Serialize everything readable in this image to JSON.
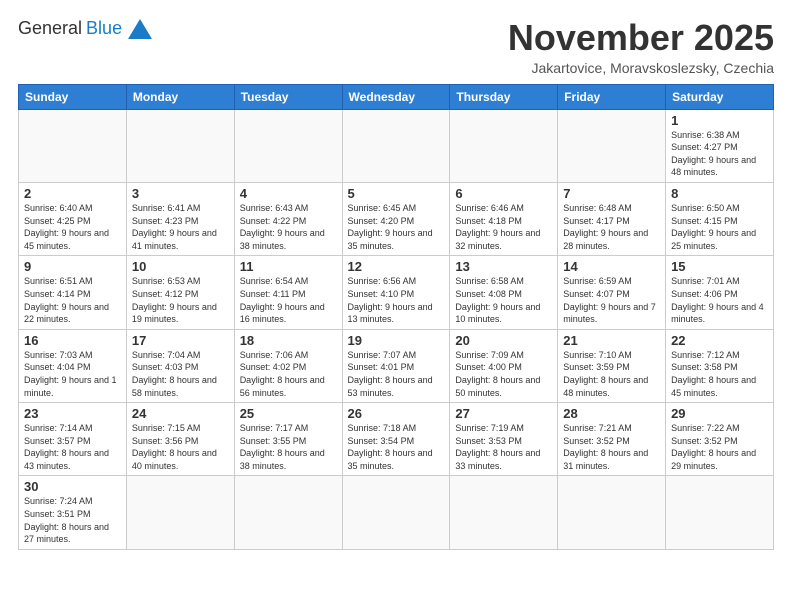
{
  "header": {
    "logo_general": "General",
    "logo_blue": "Blue",
    "month_title": "November 2025",
    "subtitle": "Jakartovice, Moravskoslezsky, Czechia"
  },
  "weekdays": [
    "Sunday",
    "Monday",
    "Tuesday",
    "Wednesday",
    "Thursday",
    "Friday",
    "Saturday"
  ],
  "weeks": [
    [
      {
        "day": "",
        "info": ""
      },
      {
        "day": "",
        "info": ""
      },
      {
        "day": "",
        "info": ""
      },
      {
        "day": "",
        "info": ""
      },
      {
        "day": "",
        "info": ""
      },
      {
        "day": "",
        "info": ""
      },
      {
        "day": "1",
        "info": "Sunrise: 6:38 AM\nSunset: 4:27 PM\nDaylight: 9 hours and 48 minutes."
      }
    ],
    [
      {
        "day": "2",
        "info": "Sunrise: 6:40 AM\nSunset: 4:25 PM\nDaylight: 9 hours and 45 minutes."
      },
      {
        "day": "3",
        "info": "Sunrise: 6:41 AM\nSunset: 4:23 PM\nDaylight: 9 hours and 41 minutes."
      },
      {
        "day": "4",
        "info": "Sunrise: 6:43 AM\nSunset: 4:22 PM\nDaylight: 9 hours and 38 minutes."
      },
      {
        "day": "5",
        "info": "Sunrise: 6:45 AM\nSunset: 4:20 PM\nDaylight: 9 hours and 35 minutes."
      },
      {
        "day": "6",
        "info": "Sunrise: 6:46 AM\nSunset: 4:18 PM\nDaylight: 9 hours and 32 minutes."
      },
      {
        "day": "7",
        "info": "Sunrise: 6:48 AM\nSunset: 4:17 PM\nDaylight: 9 hours and 28 minutes."
      },
      {
        "day": "8",
        "info": "Sunrise: 6:50 AM\nSunset: 4:15 PM\nDaylight: 9 hours and 25 minutes."
      }
    ],
    [
      {
        "day": "9",
        "info": "Sunrise: 6:51 AM\nSunset: 4:14 PM\nDaylight: 9 hours and 22 minutes."
      },
      {
        "day": "10",
        "info": "Sunrise: 6:53 AM\nSunset: 4:12 PM\nDaylight: 9 hours and 19 minutes."
      },
      {
        "day": "11",
        "info": "Sunrise: 6:54 AM\nSunset: 4:11 PM\nDaylight: 9 hours and 16 minutes."
      },
      {
        "day": "12",
        "info": "Sunrise: 6:56 AM\nSunset: 4:10 PM\nDaylight: 9 hours and 13 minutes."
      },
      {
        "day": "13",
        "info": "Sunrise: 6:58 AM\nSunset: 4:08 PM\nDaylight: 9 hours and 10 minutes."
      },
      {
        "day": "14",
        "info": "Sunrise: 6:59 AM\nSunset: 4:07 PM\nDaylight: 9 hours and 7 minutes."
      },
      {
        "day": "15",
        "info": "Sunrise: 7:01 AM\nSunset: 4:06 PM\nDaylight: 9 hours and 4 minutes."
      }
    ],
    [
      {
        "day": "16",
        "info": "Sunrise: 7:03 AM\nSunset: 4:04 PM\nDaylight: 9 hours and 1 minute."
      },
      {
        "day": "17",
        "info": "Sunrise: 7:04 AM\nSunset: 4:03 PM\nDaylight: 8 hours and 58 minutes."
      },
      {
        "day": "18",
        "info": "Sunrise: 7:06 AM\nSunset: 4:02 PM\nDaylight: 8 hours and 56 minutes."
      },
      {
        "day": "19",
        "info": "Sunrise: 7:07 AM\nSunset: 4:01 PM\nDaylight: 8 hours and 53 minutes."
      },
      {
        "day": "20",
        "info": "Sunrise: 7:09 AM\nSunset: 4:00 PM\nDaylight: 8 hours and 50 minutes."
      },
      {
        "day": "21",
        "info": "Sunrise: 7:10 AM\nSunset: 3:59 PM\nDaylight: 8 hours and 48 minutes."
      },
      {
        "day": "22",
        "info": "Sunrise: 7:12 AM\nSunset: 3:58 PM\nDaylight: 8 hours and 45 minutes."
      }
    ],
    [
      {
        "day": "23",
        "info": "Sunrise: 7:14 AM\nSunset: 3:57 PM\nDaylight: 8 hours and 43 minutes."
      },
      {
        "day": "24",
        "info": "Sunrise: 7:15 AM\nSunset: 3:56 PM\nDaylight: 8 hours and 40 minutes."
      },
      {
        "day": "25",
        "info": "Sunrise: 7:17 AM\nSunset: 3:55 PM\nDaylight: 8 hours and 38 minutes."
      },
      {
        "day": "26",
        "info": "Sunrise: 7:18 AM\nSunset: 3:54 PM\nDaylight: 8 hours and 35 minutes."
      },
      {
        "day": "27",
        "info": "Sunrise: 7:19 AM\nSunset: 3:53 PM\nDaylight: 8 hours and 33 minutes."
      },
      {
        "day": "28",
        "info": "Sunrise: 7:21 AM\nSunset: 3:52 PM\nDaylight: 8 hours and 31 minutes."
      },
      {
        "day": "29",
        "info": "Sunrise: 7:22 AM\nSunset: 3:52 PM\nDaylight: 8 hours and 29 minutes."
      }
    ],
    [
      {
        "day": "30",
        "info": "Sunrise: 7:24 AM\nSunset: 3:51 PM\nDaylight: 8 hours and 27 minutes."
      },
      {
        "day": "",
        "info": ""
      },
      {
        "day": "",
        "info": ""
      },
      {
        "day": "",
        "info": ""
      },
      {
        "day": "",
        "info": ""
      },
      {
        "day": "",
        "info": ""
      },
      {
        "day": "",
        "info": ""
      }
    ]
  ]
}
